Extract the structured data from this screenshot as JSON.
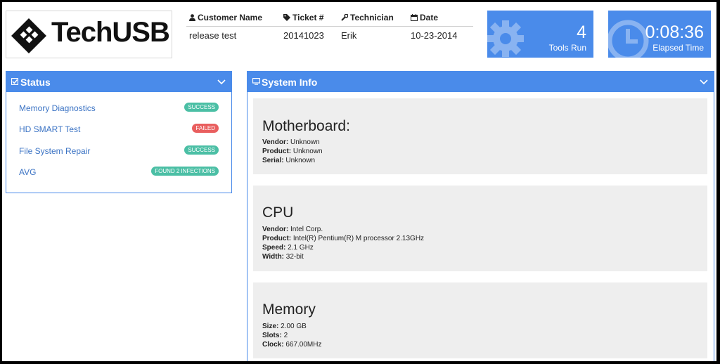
{
  "logo": {
    "text": "TechUSB"
  },
  "ticket": {
    "headers": {
      "customer": "Customer Name",
      "ticket": "Ticket #",
      "technician": "Technician",
      "date": "Date"
    },
    "values": {
      "customer": "release test",
      "ticket": "20141023",
      "technician": "Erik",
      "date": "10-23-2014"
    }
  },
  "tiles": {
    "tools": {
      "value": "4",
      "label": "Tools Run",
      "icon": "gear-icon"
    },
    "elapsed": {
      "value": "0:08:36",
      "label": "Elapsed Time",
      "icon": "clock-icon"
    }
  },
  "status_panel": {
    "title": "Status",
    "items": [
      {
        "name": "Memory Diagnostics",
        "badge": "SUCCESS",
        "state": "success"
      },
      {
        "name": "HD SMART Test",
        "badge": "FAILED",
        "state": "failed"
      },
      {
        "name": "File System Repair",
        "badge": "SUCCESS",
        "state": "success"
      },
      {
        "name": "AVG",
        "badge": "FOUND 2 INFECTIONS",
        "state": "success"
      }
    ]
  },
  "system_panel": {
    "title": "System Info",
    "motherboard": {
      "title": "Motherboard:",
      "rows": [
        {
          "key": "Vendor:",
          "value": "Unknown"
        },
        {
          "key": "Product:",
          "value": "Unknown"
        },
        {
          "key": "Serial:",
          "value": "Unknown"
        }
      ]
    },
    "cpu": {
      "title": "CPU",
      "rows": [
        {
          "key": "Vendor:",
          "value": "Intel Corp."
        },
        {
          "key": "Product:",
          "value": "Intel(R) Pentium(R) M processor 2.13GHz"
        },
        {
          "key": "Speed:",
          "value": "2.1 GHz"
        },
        {
          "key": "Width:",
          "value": "32-bit"
        }
      ]
    },
    "memory": {
      "title": "Memory",
      "rows": [
        {
          "key": "Size:",
          "value": "2.00 GB"
        },
        {
          "key": "Slots:",
          "value": "2"
        },
        {
          "key": "Clock:",
          "value": "667.00MHz"
        }
      ]
    }
  },
  "colors": {
    "accent": "#4a8bea",
    "success": "#4bbfa5",
    "failed": "#e95f5f",
    "card": "#eeeeee",
    "link": "#3b73c4"
  }
}
